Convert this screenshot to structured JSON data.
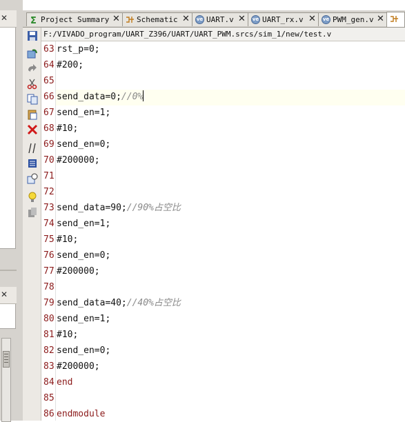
{
  "left_panel": {
    "close_glyph": "✕"
  },
  "tabs": [
    {
      "label": "Project Summary",
      "icon": "sigma-icon",
      "close": "✕"
    },
    {
      "label": "Schematic",
      "icon": "schematic-icon",
      "close": "✕"
    },
    {
      "label": "UART.v",
      "icon": "verilog-file-icon",
      "close": "✕"
    },
    {
      "label": "UART_rx.v",
      "icon": "verilog-file-icon",
      "close": "✕"
    },
    {
      "label": "PWM_gen.v",
      "icon": "verilog-file-icon",
      "close": "✕"
    }
  ],
  "editor": {
    "file_path": "F:/VIVADO_program/UART_Z396/UART/UART_PWM.srcs/sim_1/new/test.v",
    "toolbar": [
      "save-icon",
      "refresh-icon",
      "undo-icon",
      "cut-icon",
      "copy-icon",
      "paste-icon",
      "delete-icon",
      "comment-icon",
      "select-block-icon",
      "template-icon",
      "lightbulb-icon",
      "bookmark-icon"
    ],
    "current_line": 66,
    "lines": [
      {
        "num": "63",
        "code": "rst_p=0;",
        "comment": ""
      },
      {
        "num": "64",
        "code": "#200;",
        "comment": ""
      },
      {
        "num": "65",
        "code": "",
        "comment": ""
      },
      {
        "num": "66",
        "code": "send_data=0;",
        "comment": "//0%"
      },
      {
        "num": "67",
        "code": "send_en=1;",
        "comment": ""
      },
      {
        "num": "68",
        "code": "#10;",
        "comment": ""
      },
      {
        "num": "69",
        "code": "send_en=0;",
        "comment": ""
      },
      {
        "num": "70",
        "code": "#200000;",
        "comment": ""
      },
      {
        "num": "71",
        "code": "",
        "comment": ""
      },
      {
        "num": "72",
        "code": "",
        "comment": ""
      },
      {
        "num": "73",
        "code": "send_data=90;",
        "comment": "//90%占空比"
      },
      {
        "num": "74",
        "code": "send_en=1;",
        "comment": ""
      },
      {
        "num": "75",
        "code": "#10;",
        "comment": ""
      },
      {
        "num": "76",
        "code": "send_en=0;",
        "comment": ""
      },
      {
        "num": "77",
        "code": "#200000;",
        "comment": ""
      },
      {
        "num": "78",
        "code": "",
        "comment": ""
      },
      {
        "num": "79",
        "code": "send_data=40;",
        "comment": "//40%占空比"
      },
      {
        "num": "80",
        "code": "send_en=1;",
        "comment": ""
      },
      {
        "num": "81",
        "code": "#10;",
        "comment": ""
      },
      {
        "num": "82",
        "code": "send_en=0;",
        "comment": ""
      },
      {
        "num": "83",
        "code": "#200000;",
        "comment": ""
      },
      {
        "num": "84",
        "code": "end",
        "comment": "",
        "keyword": true
      },
      {
        "num": "85",
        "code": "",
        "comment": ""
      },
      {
        "num": "86",
        "code": "endmodule",
        "comment": "",
        "keyword": true
      }
    ]
  }
}
